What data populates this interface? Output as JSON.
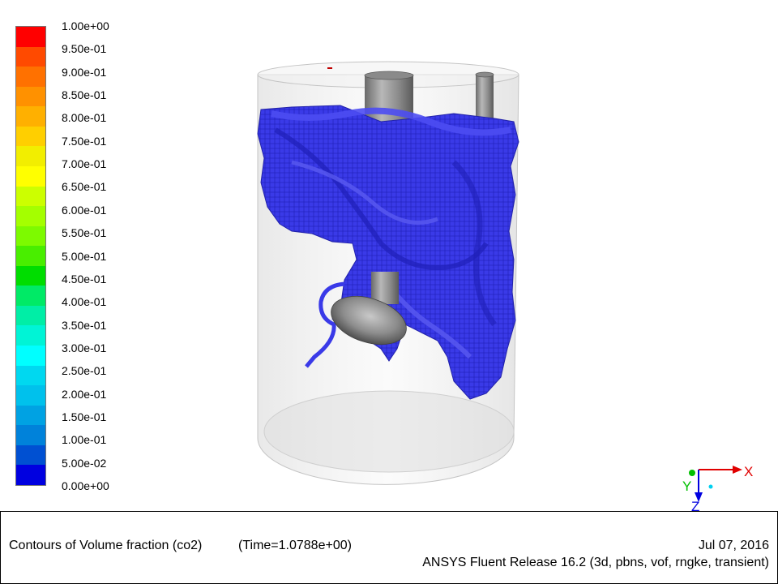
{
  "colorbar": {
    "colors": [
      "#ff0000",
      "#ff4a00",
      "#ff7100",
      "#ff9100",
      "#ffb000",
      "#ffcf00",
      "#f2ee00",
      "#ffff00",
      "#ccff00",
      "#a4ff00",
      "#7dfa00",
      "#49ee00",
      "#00dd00",
      "#00ea66",
      "#00eea6",
      "#00f4d6",
      "#00ffff",
      "#00d8f0",
      "#00c1ec",
      "#00a2e3",
      "#0082da",
      "#0050d2",
      "#0000e0"
    ],
    "labels": [
      "1.00e+00",
      "9.50e-01",
      "9.00e-01",
      "8.50e-01",
      "8.00e-01",
      "7.50e-01",
      "7.00e-01",
      "6.50e-01",
      "6.00e-01",
      "5.50e-01",
      "5.00e-01",
      "4.50e-01",
      "4.00e-01",
      "3.50e-01",
      "3.00e-01",
      "2.50e-01",
      "2.00e-01",
      "1.50e-01",
      "1.00e-01",
      "5.00e-02",
      "0.00e+00"
    ]
  },
  "axes": {
    "x_label": "X",
    "y_label": "Y",
    "z_label": "Z",
    "x_color": "#e00000",
    "y_color": "#00c000",
    "z_color": "#0000e0"
  },
  "scene": {
    "isosurface_color": "#3a3ae8",
    "isosurface_shadow": "#1c1cb0",
    "solid_color": "#9a9a9a"
  },
  "footer": {
    "caption": "Contours of Volume fraction (co2)",
    "time": "(Time=1.0788e+00)",
    "date": "Jul 07, 2016",
    "release": "ANSYS Fluent Release 16.2 (3d, pbns, vof, rngke, transient)"
  }
}
